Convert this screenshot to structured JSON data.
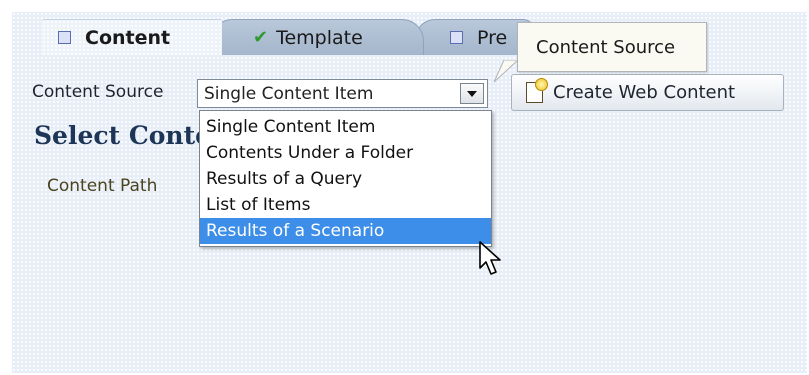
{
  "tabs": [
    {
      "label": "Content",
      "icon": "square-icon"
    },
    {
      "label": "Template",
      "icon": "check-icon"
    },
    {
      "label": "Pre",
      "icon": "square-icon"
    }
  ],
  "tooltip": {
    "text": "Content Source"
  },
  "content_source": {
    "label": "Content Source",
    "selected_value": "Single Content Item",
    "options": [
      "Single Content Item",
      "Contents Under a Folder",
      "Results of a Query",
      "List of Items",
      "Results of a Scenario"
    ],
    "highlighted_option": "Results of a Scenario"
  },
  "create_button": {
    "label": "Create Web Content",
    "icon": "new-document-icon"
  },
  "section": {
    "title": "Select Conte",
    "content_path_label": "Content Path"
  },
  "colors": {
    "panel_bg": "#e8eef7",
    "highlight": "#3d8ee8",
    "tab_inactive": "#a4b6cc",
    "title": "#1d3657"
  }
}
